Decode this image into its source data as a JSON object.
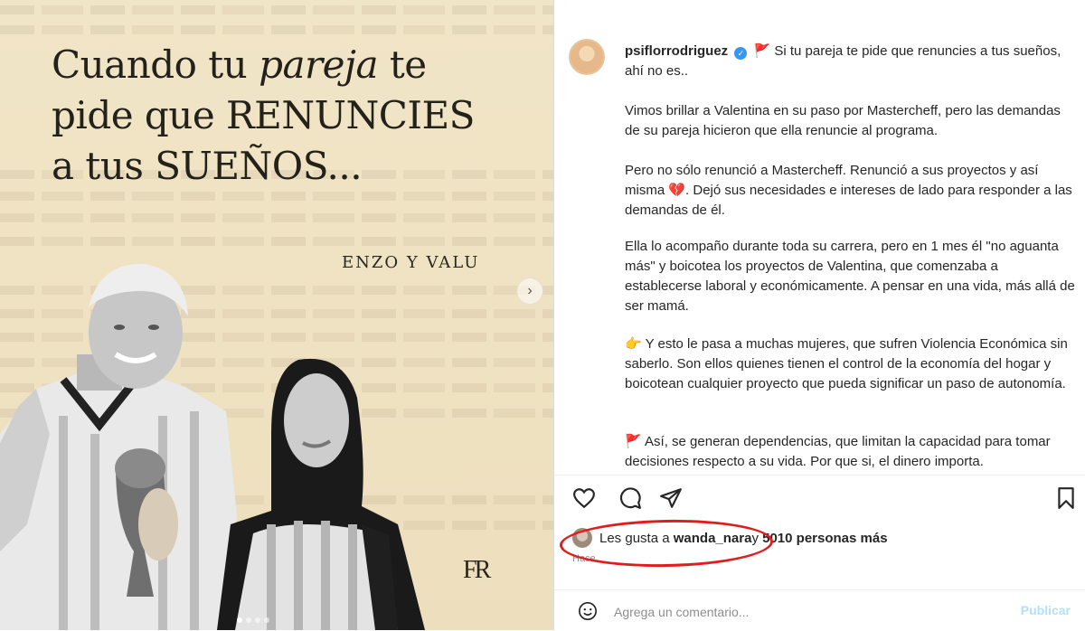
{
  "image": {
    "headline": {
      "line1_a": "Cuando tu ",
      "line1_italic": "pareja",
      "line1_b": " te",
      "line2": "pide que RENUNCIES",
      "line3": "a tus SUEÑOS..."
    },
    "names": "ENZO Y VALU",
    "monogram": "FR",
    "next_icon": "chevron-right-icon",
    "carousel_dots": 4,
    "active_dot": 1
  },
  "post": {
    "username": "psiflorrodriguez",
    "verified_icon": "verified-badge-icon",
    "flag_icon": "red-flag-icon",
    "intro": "Si tu pareja te pide que renuncies a tus sueños, ahí no es..",
    "paragraphs": {
      "p1": "Vimos brillar a Valentina en su paso por Mastercheff, pero las demandas de su pareja hicieron que ella renuncie al programa.",
      "p2_a": "Pero no sólo renunció a Mastercheff. Renunció a sus proyectos y así misma",
      "p2_b": ". Dejó sus necesidades e intereses de lado para responder a las demandas de él.",
      "p3": "Ella lo acompaño durante toda su carrera, pero en 1 mes él \"no aguanta más\" y boicotea los proyectos de Valentina, que comenzaba a establecerse laboral y económicamente. A pensar en una vida, más allá de ser mamá.",
      "p4": "Y esto le pasa a muchas mujeres, que sufren Violencia Económica sin saberlo. Son ellos quienes tienen el control de la economía del hogar y boicotean cualquier proyecto que pueda significar un paso de autonomía.",
      "p5": "Así, se generan dependencias, que limitan la capacidad para tomar decisiones respecto a su vida. Por que si, el dinero importa."
    },
    "emoji": {
      "broken_heart": "💔",
      "point_hand": "👉",
      "flag": "🚩"
    }
  },
  "actions": {
    "like_icon": "heart-icon",
    "comment_icon": "comment-icon",
    "share_icon": "share-icon",
    "save_icon": "bookmark-icon"
  },
  "likes": {
    "prefix": "Les gusta a ",
    "user": "wanda_nara",
    "connector": " y ",
    "others": "5010 personas más"
  },
  "timestamp": "Hace",
  "comment": {
    "emoji_icon": "smiley-icon",
    "placeholder": "Agrega un comentario...",
    "publish": "Publicar"
  },
  "colors": {
    "link_blue": "#b2dffc",
    "annotation_red": "#e11c1c",
    "verified_blue": "#3897f0"
  }
}
